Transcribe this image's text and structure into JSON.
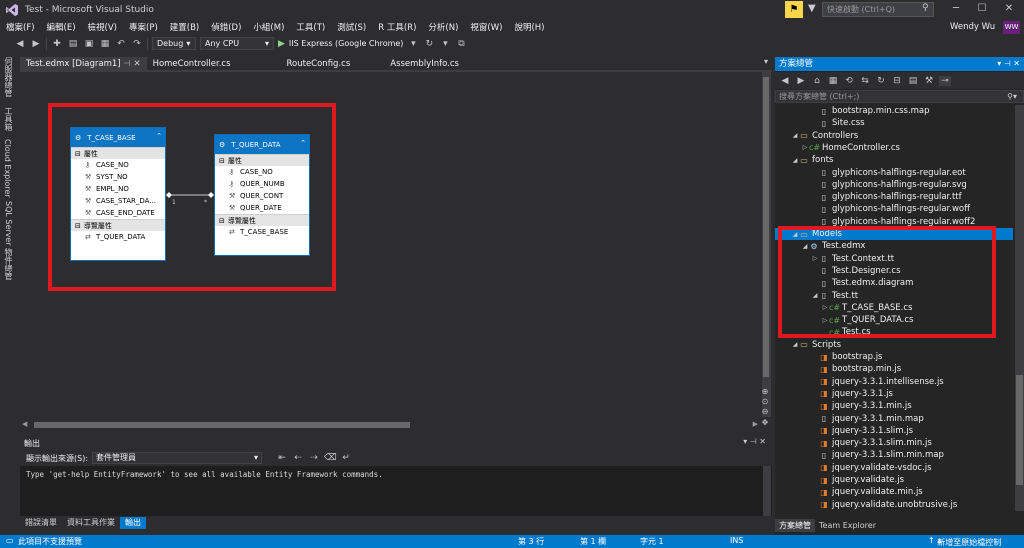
{
  "window": {
    "title": "Test - Microsoft Visual Studio",
    "quick_launch_placeholder": "快速啟動 (Ctrl+Q)",
    "user_name": "Wendy Wu",
    "user_initials": "WW"
  },
  "menu": [
    "檔案(F)",
    "編輯(E)",
    "檢視(V)",
    "專案(P)",
    "建置(B)",
    "偵錯(D)",
    "小組(M)",
    "工具(T)",
    "測試(S)",
    "R 工具(R)",
    "分析(N)",
    "視窗(W)",
    "說明(H)"
  ],
  "toolbar": {
    "config": "Debug",
    "platform": "Any CPU",
    "run_target": "IIS Express (Google Chrome)"
  },
  "left_strip": [
    "伺服器總管",
    "工具箱",
    "Cloud Explorer",
    "SQL Server 物件總管"
  ],
  "doc_tabs": [
    {
      "label": "Test.edmx [Diagram1]",
      "active": true
    },
    {
      "label": "HomeController.cs",
      "active": false
    },
    {
      "label": "RouteConfig.cs",
      "active": false
    },
    {
      "label": "AssemblyInfo.cs",
      "active": false
    }
  ],
  "diagram": {
    "entities": [
      {
        "name": "T_CASE_BASE",
        "properties_label": "屬性",
        "properties": [
          "CASE_NO",
          "SYST_NO",
          "EMPL_NO",
          "CASE_STAR_DA...",
          "CASE_END_DATE"
        ],
        "nav_label": "導覽屬性",
        "nav_properties": [
          "T_QUER_DATA"
        ]
      },
      {
        "name": "T_QUER_DATA",
        "properties_label": "屬性",
        "properties": [
          "CASE_NO",
          "QUER_NUMB",
          "QUER_CONT",
          "QUER_DATE"
        ],
        "nav_label": "導覽屬性",
        "nav_properties": [
          "T_CASE_BASE"
        ]
      }
    ],
    "association": {
      "left": "1",
      "right": "*"
    }
  },
  "output": {
    "title": "輸出",
    "source_label": "顯示輸出來源(S):",
    "source_value": "套件管理員",
    "text": "Type 'get-help EntityFramework' to see all available Entity Framework commands."
  },
  "bottom_tabs": [
    {
      "label": "錯誤清單",
      "active": false
    },
    {
      "label": "資料工具作業",
      "active": false
    },
    {
      "label": "輸出",
      "active": true
    }
  ],
  "status": {
    "message": "此項目不支援預覽",
    "line": "第 3 行",
    "col": "第 1 欄",
    "ch": "字元 1",
    "mode": "INS",
    "source_control": "新增至原始檔控制"
  },
  "solution_explorer": {
    "title": "方案總管",
    "search_placeholder": "搜尋方案總管 (Ctrl+;)",
    "items": [
      {
        "label": "bootstrap.min.css.map",
        "icon": "file",
        "arrow": ""
      },
      {
        "label": "Site.css",
        "icon": "file",
        "arrow": ""
      },
      {
        "label": "Controllers",
        "icon": "folder",
        "arrow": "open"
      },
      {
        "label": "HomeController.cs",
        "icon": "cs",
        "arrow": "closed"
      },
      {
        "label": "fonts",
        "icon": "folder",
        "arrow": "open"
      },
      {
        "label": "glyphicons-halflings-regular.eot",
        "icon": "file",
        "arrow": ""
      },
      {
        "label": "glyphicons-halflings-regular.svg",
        "icon": "file",
        "arrow": ""
      },
      {
        "label": "glyphicons-halflings-regular.ttf",
        "icon": "file",
        "arrow": ""
      },
      {
        "label": "glyphicons-halflings-regular.woff",
        "icon": "file",
        "arrow": ""
      },
      {
        "label": "glyphicons-halflings-regular.woff2",
        "icon": "file",
        "arrow": ""
      },
      {
        "label": "Models",
        "icon": "folder",
        "arrow": "open",
        "selected": true
      },
      {
        "label": "Test.edmx",
        "icon": "edmx",
        "arrow": "open"
      },
      {
        "label": "Test.Context.tt",
        "icon": "file",
        "arrow": "closed"
      },
      {
        "label": "Test.Designer.cs",
        "icon": "file",
        "arrow": ""
      },
      {
        "label": "Test.edmx.diagram",
        "icon": "file",
        "arrow": ""
      },
      {
        "label": "Test.tt",
        "icon": "file",
        "arrow": "open"
      },
      {
        "label": "T_CASE_BASE.cs",
        "icon": "cs",
        "arrow": "closed"
      },
      {
        "label": "T_QUER_DATA.cs",
        "icon": "cs",
        "arrow": "closed"
      },
      {
        "label": "Test.cs",
        "icon": "cs",
        "arrow": ""
      },
      {
        "label": "Scripts",
        "icon": "folder",
        "arrow": "open"
      },
      {
        "label": "bootstrap.js",
        "icon": "js",
        "arrow": ""
      },
      {
        "label": "bootstrap.min.js",
        "icon": "js",
        "arrow": ""
      },
      {
        "label": "jquery-3.3.1.intellisense.js",
        "icon": "js",
        "arrow": ""
      },
      {
        "label": "jquery-3.3.1.js",
        "icon": "js",
        "arrow": ""
      },
      {
        "label": "jquery-3.3.1.min.js",
        "icon": "js",
        "arrow": ""
      },
      {
        "label": "jquery-3.3.1.min.map",
        "icon": "file",
        "arrow": ""
      },
      {
        "label": "jquery-3.3.1.slim.js",
        "icon": "js",
        "arrow": ""
      },
      {
        "label": "jquery-3.3.1.slim.min.js",
        "icon": "js",
        "arrow": ""
      },
      {
        "label": "jquery-3.3.1.slim.min.map",
        "icon": "file",
        "arrow": ""
      },
      {
        "label": "jquery.validate-vsdoc.js",
        "icon": "js",
        "arrow": ""
      },
      {
        "label": "jquery.validate.js",
        "icon": "js",
        "arrow": ""
      },
      {
        "label": "jquery.validate.min.js",
        "icon": "js",
        "arrow": ""
      },
      {
        "label": "jquery.validate.unobtrusive.js",
        "icon": "js",
        "arrow": ""
      }
    ],
    "bottom_tabs": [
      {
        "label": "方案總管",
        "active": true
      },
      {
        "label": "Team Explorer",
        "active": false
      }
    ]
  }
}
